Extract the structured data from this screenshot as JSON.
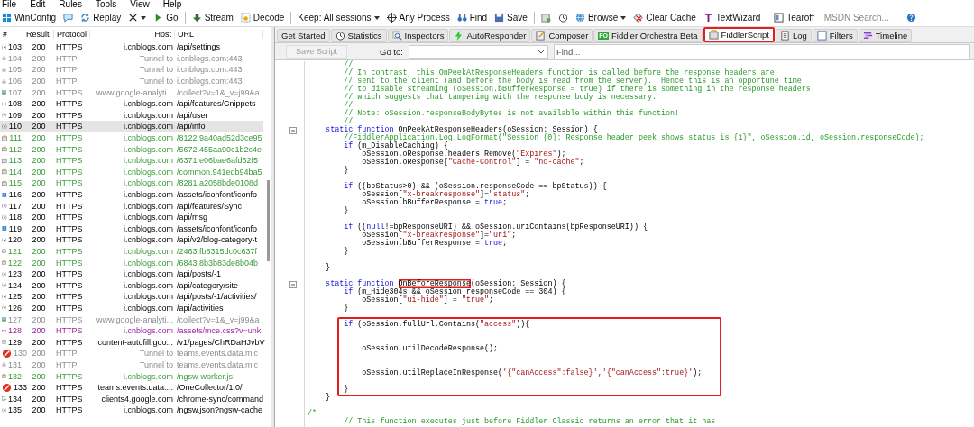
{
  "menu": [
    "File",
    "Edit",
    "Rules",
    "Tools",
    "View",
    "Help"
  ],
  "toolbar": [
    {
      "kind": "windows",
      "label": "WinConfig",
      "dropdown": false
    },
    {
      "kind": "comment",
      "dropdown": false
    },
    {
      "kind": "replay",
      "label": "Replay",
      "dropdown": false
    },
    {
      "kind": "remove",
      "dropdown": true
    },
    {
      "kind": "play",
      "label": "Go",
      "dropdown": false
    },
    {
      "kind": "separator"
    },
    {
      "kind": "stream",
      "label": "Stream",
      "dropdown": false
    },
    {
      "kind": "decode",
      "label": "Decode",
      "dropdown": false
    },
    {
      "kind": "separator"
    },
    {
      "kind": "text",
      "label": "Keep: All sessions",
      "dropdown": true
    },
    {
      "kind": "crosshair",
      "label": "Any Process",
      "dropdown": false
    },
    {
      "kind": "binoculars",
      "label": "Find",
      "dropdown": false
    },
    {
      "kind": "save",
      "label": "Save",
      "dropdown": false
    },
    {
      "kind": "separator"
    },
    {
      "kind": "camera",
      "dropdown": false
    },
    {
      "kind": "timer",
      "dropdown": false
    },
    {
      "kind": "globe",
      "label": "Browse",
      "dropdown": true
    },
    {
      "kind": "clear",
      "label": "Clear Cache",
      "dropdown": false
    },
    {
      "kind": "textwizard",
      "label": "TextWizard",
      "dropdown": false
    },
    {
      "kind": "separator"
    },
    {
      "kind": "tearoff",
      "label": "Tearoff",
      "dropdown": false
    },
    {
      "kind": "search",
      "placeholder": "MSDN Search..."
    },
    {
      "kind": "help",
      "dropdown": false
    }
  ],
  "sessions": {
    "columns": [
      "#",
      "Result",
      "Protocol",
      "Host",
      "URL"
    ],
    "rows": [
      {
        "id": "103",
        "result": "200",
        "protocol": "HTTPS",
        "host": "i.cnblogs.com",
        "url": "/api/settings",
        "kind": "json",
        "blocked": false,
        "selected": false
      },
      {
        "id": "104",
        "result": "200",
        "protocol": "HTTP",
        "host": "Tunnel to",
        "url": "i.cnblogs.com:443",
        "kind": "tunnel",
        "blocked": false,
        "selected": false
      },
      {
        "id": "105",
        "result": "200",
        "protocol": "HTTP",
        "host": "Tunnel to",
        "url": "i.cnblogs.com:443",
        "kind": "tunnel",
        "blocked": false,
        "selected": false
      },
      {
        "id": "106",
        "result": "200",
        "protocol": "HTTP",
        "host": "Tunnel to",
        "url": "i.cnblogs.com:443",
        "kind": "tunnel",
        "blocked": false,
        "selected": false
      },
      {
        "id": "107",
        "result": "200",
        "protocol": "HTTPS",
        "host": "www.google-analyti...",
        "url": "/collect?v=1&_v=j99&a",
        "kind": "image",
        "blocked": false,
        "selected": false
      },
      {
        "id": "108",
        "result": "200",
        "protocol": "HTTPS",
        "host": "i.cnblogs.com",
        "url": "/api/features/Cnippets",
        "kind": "json",
        "blocked": false,
        "selected": false
      },
      {
        "id": "109",
        "result": "200",
        "protocol": "HTTPS",
        "host": "i.cnblogs.com",
        "url": "/api/user",
        "kind": "json",
        "blocked": false,
        "selected": false
      },
      {
        "id": "110",
        "result": "200",
        "protocol": "HTTPS",
        "host": "i.cnblogs.com",
        "url": "/api/info",
        "kind": "json",
        "blocked": false,
        "selected": true
      },
      {
        "id": "111",
        "result": "200",
        "protocol": "HTTPS",
        "host": "i.cnblogs.com",
        "url": "/8122.9a40ad52d3ce95",
        "kind": "script",
        "blocked": false,
        "selected": false
      },
      {
        "id": "112",
        "result": "200",
        "protocol": "HTTPS",
        "host": "i.cnblogs.com",
        "url": "/5672.455aa90c1b2c4e",
        "kind": "script",
        "blocked": false,
        "selected": false
      },
      {
        "id": "113",
        "result": "200",
        "protocol": "HTTPS",
        "host": "i.cnblogs.com",
        "url": "/6371.e06bae6afd62f5",
        "kind": "script",
        "blocked": false,
        "selected": false
      },
      {
        "id": "114",
        "result": "200",
        "protocol": "HTTPS",
        "host": "i.cnblogs.com",
        "url": "/common.941edb94ba5",
        "kind": "script",
        "blocked": false,
        "selected": false
      },
      {
        "id": "115",
        "result": "200",
        "protocol": "HTTPS",
        "host": "i.cnblogs.com",
        "url": "/8281.a2058bde0108d",
        "kind": "script",
        "blocked": false,
        "selected": false
      },
      {
        "id": "116",
        "result": "200",
        "protocol": "HTTPS",
        "host": "i.cnblogs.com",
        "url": "/assets/iconfont/iconfo",
        "kind": "font",
        "blocked": false,
        "selected": false
      },
      {
        "id": "117",
        "result": "200",
        "protocol": "HTTPS",
        "host": "i.cnblogs.com",
        "url": "/api/features/Sync",
        "kind": "json",
        "blocked": false,
        "selected": false
      },
      {
        "id": "118",
        "result": "200",
        "protocol": "HTTPS",
        "host": "i.cnblogs.com",
        "url": "/api/msg",
        "kind": "json",
        "blocked": false,
        "selected": false
      },
      {
        "id": "119",
        "result": "200",
        "protocol": "HTTPS",
        "host": "i.cnblogs.com",
        "url": "/assets/iconfont/iconfo",
        "kind": "font",
        "blocked": false,
        "selected": false
      },
      {
        "id": "120",
        "result": "200",
        "protocol": "HTTPS",
        "host": "i.cnblogs.com",
        "url": "/api/v2/blog-category-t",
        "kind": "json",
        "blocked": false,
        "selected": false
      },
      {
        "id": "121",
        "result": "200",
        "protocol": "HTTPS",
        "host": "i.cnblogs.com",
        "url": "/2463.fb8315dc0c637f",
        "kind": "script",
        "blocked": false,
        "selected": false
      },
      {
        "id": "122",
        "result": "200",
        "protocol": "HTTPS",
        "host": "i.cnblogs.com",
        "url": "/6843.8b3b83de8b04b",
        "kind": "script",
        "blocked": false,
        "selected": false
      },
      {
        "id": "123",
        "result": "200",
        "protocol": "HTTPS",
        "host": "i.cnblogs.com",
        "url": "/api/posts/-1",
        "kind": "json",
        "blocked": false,
        "selected": false
      },
      {
        "id": "124",
        "result": "200",
        "protocol": "HTTPS",
        "host": "i.cnblogs.com",
        "url": "/api/category/site",
        "kind": "json",
        "blocked": false,
        "selected": false
      },
      {
        "id": "125",
        "result": "200",
        "protocol": "HTTPS",
        "host": "i.cnblogs.com",
        "url": "/api/posts/-1/activities/",
        "kind": "json",
        "blocked": false,
        "selected": false
      },
      {
        "id": "126",
        "result": "200",
        "protocol": "HTTPS",
        "host": "i.cnblogs.com",
        "url": "/api/activities",
        "kind": "json",
        "blocked": false,
        "selected": false
      },
      {
        "id": "127",
        "result": "200",
        "protocol": "HTTPS",
        "host": "www.google-analyti...",
        "url": "/collect?v=1&_v=j99&a",
        "kind": "image",
        "blocked": false,
        "selected": false
      },
      {
        "id": "128",
        "result": "200",
        "protocol": "HTTPS",
        "host": "i.cnblogs.com",
        "url": "/assets/mce.css?v=unk",
        "kind": "stylesheet",
        "blocked": false,
        "selected": false
      },
      {
        "id": "129",
        "result": "200",
        "protocol": "HTTPS",
        "host": "content-autofill.goo...",
        "url": "/v1/pages/ChRDaHJvbV",
        "kind": "document",
        "blocked": false,
        "selected": false
      },
      {
        "id": "130",
        "result": "200",
        "protocol": "HTTP",
        "host": "Tunnel to",
        "url": "teams.events.data.mic",
        "kind": "tunnel",
        "blocked": true,
        "selected": false
      },
      {
        "id": "131",
        "result": "200",
        "protocol": "HTTP",
        "host": "Tunnel to",
        "url": "teams.events.data.mic",
        "kind": "tunnel",
        "blocked": false,
        "selected": false
      },
      {
        "id": "132",
        "result": "200",
        "protocol": "HTTPS",
        "host": "i.cnblogs.com",
        "url": "/ngsw-worker.js",
        "kind": "script",
        "blocked": false,
        "selected": false
      },
      {
        "id": "133",
        "result": "200",
        "protocol": "HTTPS",
        "host": "teams.events.data....",
        "url": "/OneCollector/1.0/",
        "kind": "document",
        "blocked": true,
        "selected": false
      },
      {
        "id": "134",
        "result": "200",
        "protocol": "HTTPS",
        "host": "clients4.google.com",
        "url": "/chrome-sync/command",
        "kind": "redirect",
        "blocked": false,
        "selected": false
      },
      {
        "id": "135",
        "result": "200",
        "protocol": "HTTPS",
        "host": "i.cnblogs.com",
        "url": "/ngsw.json?ngsw-cache",
        "kind": "json",
        "blocked": false,
        "selected": false
      }
    ]
  },
  "tabs": [
    {
      "label": "Get Started",
      "kind": "plain",
      "selected": false,
      "highlighted": false
    },
    {
      "label": "Statistics",
      "kind": "timer",
      "selected": false,
      "highlighted": false
    },
    {
      "label": "Inspectors",
      "kind": "inspect",
      "selected": false,
      "highlighted": false
    },
    {
      "label": "AutoResponder",
      "kind": "bolt",
      "selected": false,
      "highlighted": false
    },
    {
      "label": "Composer",
      "kind": "compose",
      "selected": false,
      "highlighted": false
    },
    {
      "label": "Fiddler Orchestra Beta",
      "kind": "badge",
      "badge": "FO",
      "selected": false,
      "highlighted": false
    },
    {
      "label": "FiddlerScript",
      "kind": "script",
      "selected": true,
      "highlighted": true
    },
    {
      "label": "Log",
      "kind": "log",
      "selected": false,
      "highlighted": false
    },
    {
      "label": "Filters",
      "kind": "checkbox",
      "selected": false,
      "highlighted": false
    },
    {
      "label": "Timeline",
      "kind": "timeline",
      "selected": false,
      "highlighted": false
    }
  ],
  "script_toolbar": {
    "save_button": {
      "label": "Save Script",
      "disabled": true
    },
    "goto_label": "Go to:",
    "find_placeholder": "Find..."
  },
  "code": [
    {
      "kind": "line",
      "fold": false,
      "segs": [
        {
          "kind": "comment",
          "text": "        //"
        }
      ]
    },
    {
      "kind": "line",
      "fold": false,
      "segs": [
        {
          "kind": "comment",
          "text": "        // In contrast, this OnPeekAtResponseHeaders function is called before the response headers are"
        }
      ]
    },
    {
      "kind": "line",
      "fold": false,
      "segs": [
        {
          "kind": "comment",
          "text": "        // sent to the client (and before the body is read from the server).  Hence this is an opportune time"
        }
      ]
    },
    {
      "kind": "line",
      "fold": false,
      "segs": [
        {
          "kind": "comment",
          "text": "        // to disable streaming (oSession.bBufferResponse = true) if there is something in the response headers"
        }
      ]
    },
    {
      "kind": "line",
      "fold": false,
      "segs": [
        {
          "kind": "comment",
          "text": "        // which suggests that tampering with the response body is necessary."
        }
      ]
    },
    {
      "kind": "line",
      "fold": false,
      "segs": [
        {
          "kind": "comment",
          "text": "        //"
        }
      ]
    },
    {
      "kind": "line",
      "fold": false,
      "segs": [
        {
          "kind": "comment",
          "text": "        // Note: oSession.responseBodyBytes is not available within this function!"
        }
      ]
    },
    {
      "kind": "line",
      "fold": false,
      "segs": [
        {
          "kind": "comment",
          "text": "        //"
        }
      ]
    },
    {
      "kind": "line",
      "fold": true,
      "segs": [
        {
          "kind": "keyword",
          "text": "    static function "
        },
        {
          "kind": "plain",
          "text": "OnPeekAtResponseHeaders(oSession: Session) {"
        }
      ]
    },
    {
      "kind": "line",
      "fold": false,
      "segs": [
        {
          "kind": "comment",
          "text": "        //FiddlerApplication.Log.LogFormat(\"Session {0}: Response header peek shows status is {1}\", oSession.id, oSession.responseCode);"
        }
      ]
    },
    {
      "kind": "line",
      "fold": false,
      "segs": [
        {
          "kind": "keyword",
          "text": "        if "
        },
        {
          "kind": "plain",
          "text": "(m_DisableCaching) {"
        }
      ]
    },
    {
      "kind": "line",
      "fold": false,
      "segs": [
        {
          "kind": "plain",
          "text": "            oSession.oResponse.headers.Remove("
        },
        {
          "kind": "string",
          "text": "\"Expires\""
        },
        {
          "kind": "plain",
          "text": ");"
        }
      ]
    },
    {
      "kind": "line",
      "fold": false,
      "segs": [
        {
          "kind": "plain",
          "text": "            oSession.oResponse["
        },
        {
          "kind": "string",
          "text": "\"Cache-Control\""
        },
        {
          "kind": "plain",
          "text": "] = "
        },
        {
          "kind": "string",
          "text": "\"no-cache\""
        },
        {
          "kind": "plain",
          "text": ";"
        }
      ]
    },
    {
      "kind": "line",
      "fold": false,
      "segs": [
        {
          "kind": "plain",
          "text": "        }"
        }
      ]
    },
    {
      "kind": "blank"
    },
    {
      "kind": "line",
      "fold": false,
      "segs": [
        {
          "kind": "keyword",
          "text": "        if "
        },
        {
          "kind": "plain",
          "text": "((bpStatus>0) && (oSession.responseCode == bpStatus)) {"
        }
      ]
    },
    {
      "kind": "line",
      "fold": false,
      "segs": [
        {
          "kind": "plain",
          "text": "            oSession["
        },
        {
          "kind": "string",
          "text": "\"x-breakresponse\""
        },
        {
          "kind": "plain",
          "text": "]="
        },
        {
          "kind": "string",
          "text": "\"status\""
        },
        {
          "kind": "plain",
          "text": ";"
        }
      ]
    },
    {
      "kind": "line",
      "fold": false,
      "segs": [
        {
          "kind": "plain",
          "text": "            oSession.bBufferResponse = "
        },
        {
          "kind": "keyword",
          "text": "true"
        },
        {
          "kind": "plain",
          "text": ";"
        }
      ]
    },
    {
      "kind": "line",
      "fold": false,
      "segs": [
        {
          "kind": "plain",
          "text": "        }"
        }
      ]
    },
    {
      "kind": "blank"
    },
    {
      "kind": "line",
      "fold": false,
      "segs": [
        {
          "kind": "keyword",
          "text": "        if "
        },
        {
          "kind": "plain",
          "text": "(("
        },
        {
          "kind": "keyword",
          "text": "null"
        },
        {
          "kind": "plain",
          "text": "!=bpResponseURI) && oSession.uriContains(bpResponseURI)) {"
        }
      ]
    },
    {
      "kind": "line",
      "fold": false,
      "segs": [
        {
          "kind": "plain",
          "text": "            oSession["
        },
        {
          "kind": "string",
          "text": "\"x-breakresponse\""
        },
        {
          "kind": "plain",
          "text": "]="
        },
        {
          "kind": "string",
          "text": "\"uri\""
        },
        {
          "kind": "plain",
          "text": ";"
        }
      ]
    },
    {
      "kind": "line",
      "fold": false,
      "segs": [
        {
          "kind": "plain",
          "text": "            oSession.bBufferResponse = "
        },
        {
          "kind": "keyword",
          "text": "true"
        },
        {
          "kind": "plain",
          "text": ";"
        }
      ]
    },
    {
      "kind": "line",
      "fold": false,
      "segs": [
        {
          "kind": "plain",
          "text": "        }"
        }
      ]
    },
    {
      "kind": "blank"
    },
    {
      "kind": "line",
      "fold": false,
      "segs": [
        {
          "kind": "plain",
          "text": "    }"
        }
      ]
    },
    {
      "kind": "blank"
    },
    {
      "kind": "line",
      "fold": true,
      "segs": [
        {
          "kind": "keyword",
          "text": "    static function "
        },
        {
          "kind": "marked",
          "text": "OnBeforeResponse"
        },
        {
          "kind": "plain",
          "text": "(oSession: Session) {"
        }
      ]
    },
    {
      "kind": "line",
      "fold": false,
      "segs": [
        {
          "kind": "keyword",
          "text": "        if "
        },
        {
          "kind": "plain",
          "text": "(m_Hide304s && oSession.responseCode == 304) {"
        }
      ]
    },
    {
      "kind": "line",
      "fold": false,
      "segs": [
        {
          "kind": "plain",
          "text": "            oSession["
        },
        {
          "kind": "string",
          "text": "\"ui-hide\""
        },
        {
          "kind": "plain",
          "text": "] = "
        },
        {
          "kind": "string",
          "text": "\"true\""
        },
        {
          "kind": "plain",
          "text": ";"
        }
      ]
    },
    {
      "kind": "line",
      "fold": false,
      "segs": [
        {
          "kind": "plain",
          "text": "        }"
        }
      ]
    },
    {
      "kind": "blank"
    },
    {
      "kind": "annotated",
      "lines": [
        {
          "kind": "line",
          "fold": false,
          "segs": [
            {
              "kind": "keyword",
              "text": "        if "
            },
            {
              "kind": "plain",
              "text": "(oSession.fullUrl.Contains("
            },
            {
              "kind": "string",
              "text": "\"access\""
            },
            {
              "kind": "plain",
              "text": ")){"
            }
          ]
        },
        {
          "kind": "blank"
        },
        {
          "kind": "blank"
        },
        {
          "kind": "line",
          "fold": false,
          "segs": [
            {
              "kind": "plain",
              "text": "            oSession.utilDecodeResponse();"
            }
          ]
        },
        {
          "kind": "blank"
        },
        {
          "kind": "blank"
        },
        {
          "kind": "line",
          "fold": false,
          "segs": [
            {
              "kind": "plain",
              "text": "            oSession.utilReplaceInResponse("
            },
            {
              "kind": "string",
              "text": "'{\"canAccess\":false}',"
            },
            {
              "kind": "string",
              "text": "'{\"canAccess\":true}'"
            },
            {
              "kind": "plain",
              "text": ");"
            }
          ]
        },
        {
          "kind": "blank"
        },
        {
          "kind": "line",
          "fold": false,
          "segs": [
            {
              "kind": "plain",
              "text": "        }"
            }
          ]
        }
      ]
    },
    {
      "kind": "line",
      "fold": false,
      "segs": [
        {
          "kind": "plain",
          "text": "    }"
        }
      ]
    },
    {
      "kind": "blank"
    },
    {
      "kind": "line",
      "fold": false,
      "segs": [
        {
          "kind": "comment",
          "text": "/*"
        }
      ]
    },
    {
      "kind": "line",
      "fold": false,
      "segs": [
        {
          "kind": "comment",
          "text": "        // This function executes just before Fiddler Classic returns an error that it has"
        }
      ]
    }
  ]
}
